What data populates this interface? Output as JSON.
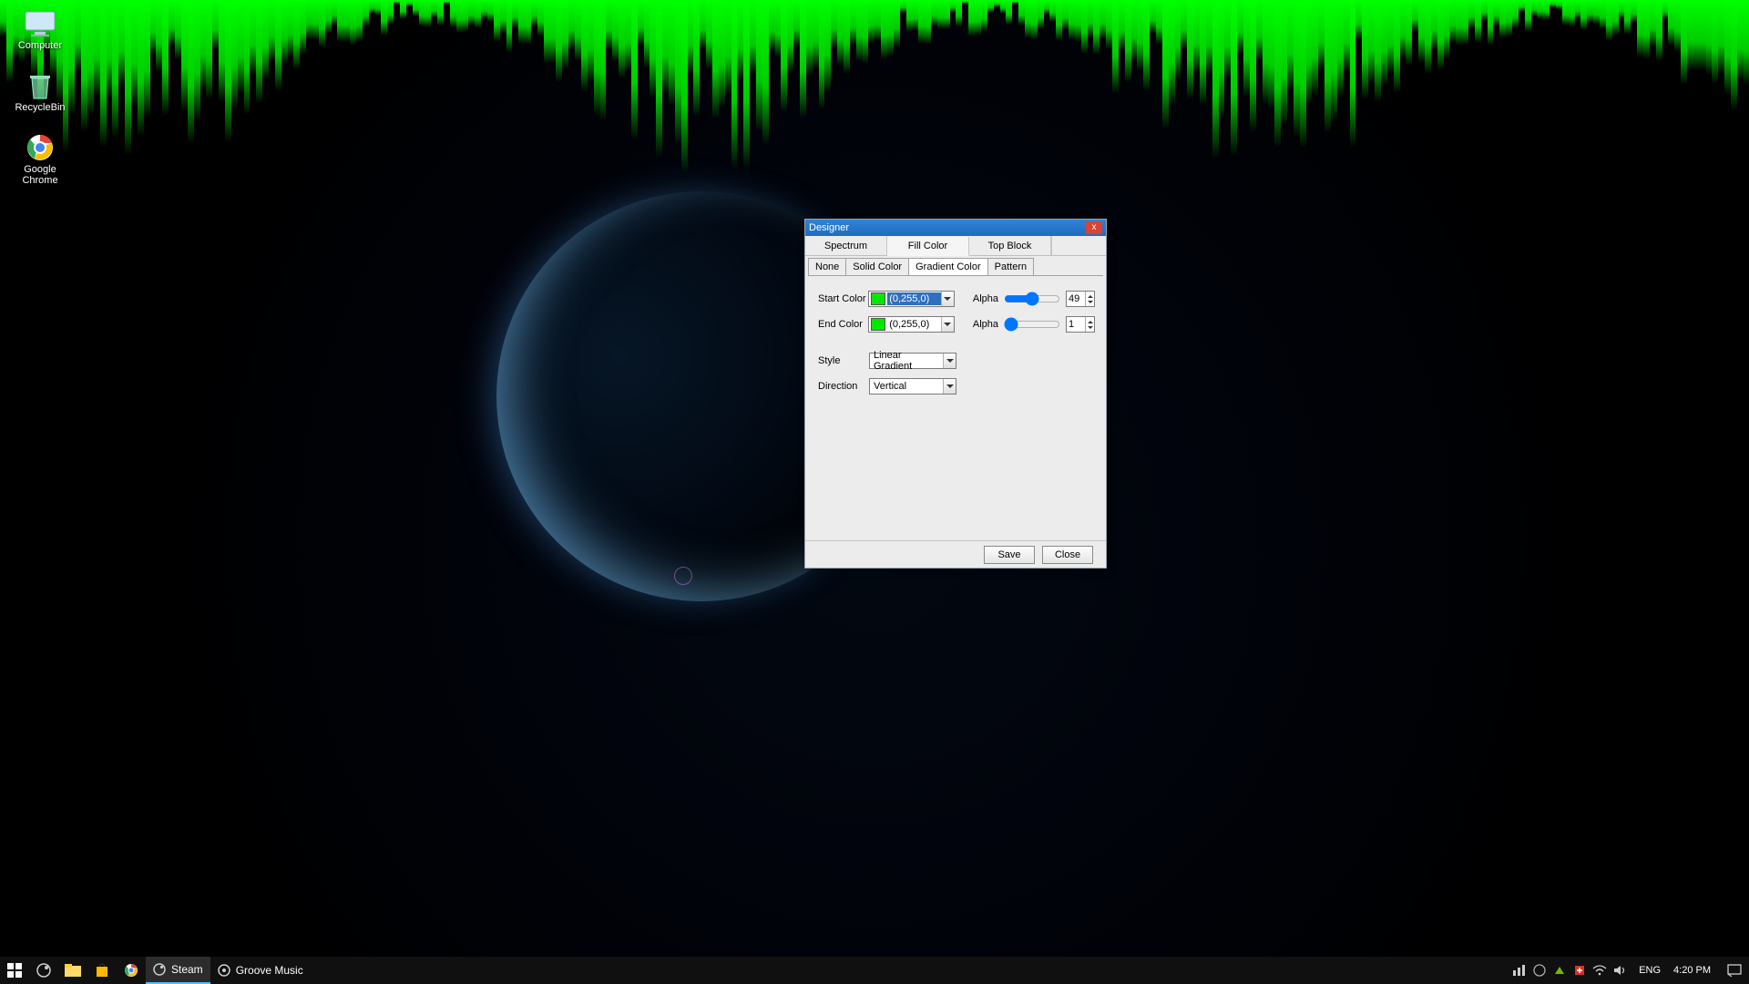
{
  "desktop": {
    "icons": [
      "Computer",
      "RecycleBin",
      "Google Chrome"
    ]
  },
  "window": {
    "title": "Designer",
    "close_label": "x",
    "main_tabs": [
      "Spectrum",
      "Fill Color",
      "Top Block"
    ],
    "main_active_index": 1,
    "sub_tabs": [
      "None",
      "Solid Color",
      "Gradient Color",
      "Pattern"
    ],
    "sub_active_index": 2,
    "labels": {
      "start_color": "Start Color",
      "end_color": "End Color",
      "alpha": "Alpha",
      "style": "Style",
      "direction": "Direction"
    },
    "start_color": {
      "value": "(0,255,0)",
      "swatch": "#00e800",
      "selected": true
    },
    "end_color": {
      "value": "(0,255,0)",
      "swatch": "#00e800"
    },
    "alpha_start": 49,
    "alpha_end": 1,
    "style_value": "Linear Gradient",
    "direction_value": "Vertical",
    "buttons": {
      "save": "Save",
      "close": "Close"
    }
  },
  "taskbar": {
    "apps": [
      {
        "label": "Steam",
        "active": true
      },
      {
        "label": "Groove Music",
        "active": false
      }
    ],
    "lang": "ENG",
    "clock": "4:20 PM"
  }
}
